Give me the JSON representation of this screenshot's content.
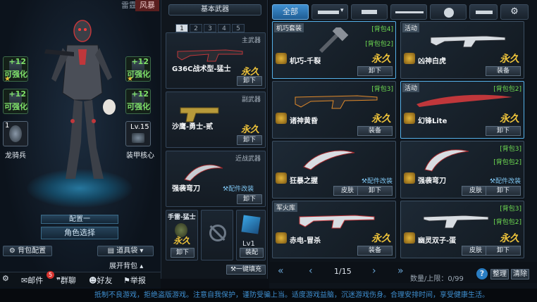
{
  "left": {
    "factions": [
      "雷霆",
      "风暴"
    ],
    "slots": [
      {
        "plus": "+12",
        "caption": "可强化"
      },
      {
        "plus": "+12",
        "caption": "可强化"
      },
      {
        "plus": "+12",
        "caption": "可强化"
      },
      {
        "plus": "+12",
        "caption": "可强化"
      }
    ],
    "rider_count": "1",
    "rider_label": "龙骑兵",
    "armor_level": "Lv.15",
    "armor_label": "装甲核心",
    "config_label": "配置一",
    "role_select": "角色选择",
    "bag_config": "背包配置",
    "ammo_box": "道具袋",
    "expand_bag": "展开背包",
    "bottom": {
      "mail": "邮件",
      "mail_badge": "5",
      "team": "群聊",
      "friends": "好友",
      "report": "举报"
    }
  },
  "mid": {
    "title": "基本武器",
    "tabs": [
      "1",
      "2",
      "3",
      "4",
      "5"
    ],
    "primary": {
      "category": "主武器",
      "name": "G36C战术型-猛士",
      "perm": "永久",
      "action": "卸下"
    },
    "secondary": {
      "category": "副武器",
      "name": "沙鹰-勇士-贰",
      "perm": "永久",
      "action": "卸下"
    },
    "melee": {
      "category": "近战武器",
      "name": "强袭弯刀",
      "perm": "永久",
      "mod": "配件改装",
      "action": "卸下"
    },
    "grenade": {
      "name": "手雷-猛士",
      "perm": "永久",
      "action": "卸下"
    },
    "extra": {
      "level": "Lv1",
      "action": "装配"
    },
    "auto_equip": "一键填充"
  },
  "right": {
    "tabs": {
      "all": "全部"
    },
    "items": [
      {
        "tag": "机巧套装",
        "bag": "[背包4]",
        "bag2": "[背包包2]",
        "name": "机巧-千裂",
        "perm": "永久",
        "action": "卸下"
      },
      {
        "tag": "活动",
        "bag": "",
        "bag2": "",
        "name": "凶神白虎",
        "perm": "永久",
        "action": "装备"
      },
      {
        "tag": "",
        "bag": "[背包3]",
        "bag2": "",
        "name": "诸神黄昏",
        "perm": "永久",
        "action": "装备"
      },
      {
        "tag": "活动",
        "bag": "[背包包2]",
        "bag2": "",
        "name": "幻锋Lite",
        "perm": "永久",
        "action": "卸下"
      },
      {
        "tag": "",
        "bag": "",
        "bag2": "",
        "name": "狂暴之握",
        "perm": "永久",
        "mod": "配件改装",
        "skin": "皮肤",
        "action": "卸下"
      },
      {
        "tag": "",
        "bag": "[背包3]",
        "bag2": "[背包包2]",
        "name": "强袭弯刀",
        "perm": "永久",
        "mod": "配件改装",
        "skin": "皮肤",
        "action": "卸下"
      },
      {
        "tag": "军火库",
        "bag": "",
        "bag2": "",
        "name": "赤电-冒杀",
        "perm": "永久",
        "action": "装备"
      },
      {
        "tag": "",
        "bag": "[背包3]",
        "bag2": "[背包包2]",
        "name": "幽灵双子-蛋",
        "perm": "永久",
        "skin": "皮肤",
        "action": "卸下"
      }
    ],
    "pager": {
      "page": "1/15",
      "quantity": "数量/上限：0/99",
      "sort": "整理",
      "clear": "清除"
    }
  },
  "footer": "抵制不良游戏，拒绝盗版游戏。注意自我保护，谨防受骗上当。适度游戏益脑，沉迷游戏伤身。合理安排时间，享受健康生活。",
  "colors": {
    "accent": "#3f8fd0",
    "gold": "#eec33a",
    "green": "#7fe06a"
  }
}
